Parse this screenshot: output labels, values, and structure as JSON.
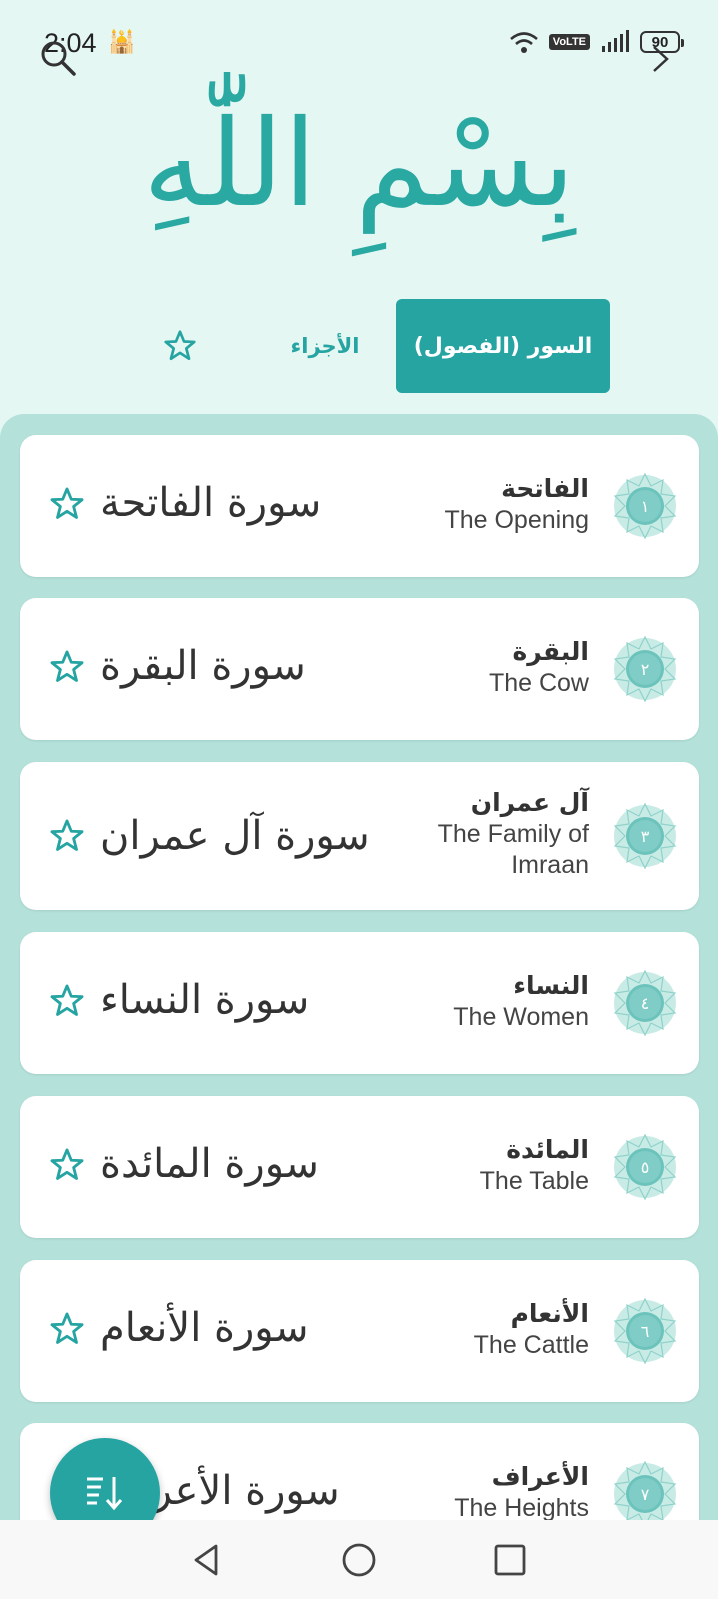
{
  "status_bar": {
    "time": "2:04",
    "network": "VoLTE",
    "battery": "90",
    "icons": [
      "mosque-icon",
      "wifi-icon",
      "volte-icon",
      "signal-icon",
      "battery-icon"
    ]
  },
  "header": {
    "bismillah": "بِسْمِ اللّٰهِ",
    "icons": [
      "search-icon",
      "chevron-right-icon"
    ]
  },
  "tabs": {
    "surahs_label": "السور (الفصول)",
    "juz_label": "الأجزاء",
    "favorites_icon": "star-outline-icon",
    "active": "surahs"
  },
  "surahs": [
    {
      "number": "١",
      "name_ar": "الفاتحة",
      "name_en": "The Opening",
      "calligraphy": "سورة الفاتحة"
    },
    {
      "number": "٢",
      "name_ar": "البقرة",
      "name_en": "The Cow",
      "calligraphy": "سورة البقرة"
    },
    {
      "number": "٣",
      "name_ar": "آل عمران",
      "name_en": "The Family of Imraan",
      "name_en_line1": "The Family of",
      "name_en_line2": "Imraan",
      "calligraphy": "سورة آل عمران"
    },
    {
      "number": "٤",
      "name_ar": "النساء",
      "name_en": "The Women",
      "calligraphy": "سورة النساء"
    },
    {
      "number": "٥",
      "name_ar": "المائدة",
      "name_en": "The Table",
      "calligraphy": "سورة المائدة"
    },
    {
      "number": "٦",
      "name_ar": "الأنعام",
      "name_en": "The Cattle",
      "calligraphy": "سورة الأنعام"
    },
    {
      "number": "٧",
      "name_ar": "الأعراف",
      "name_en": "The Heights",
      "calligraphy": "سورة الأعراف"
    }
  ],
  "fab": {
    "icon": "sort-list-icon"
  },
  "nav_bar": {
    "icons": [
      "nav-back-icon",
      "nav-home-icon",
      "nav-recents-icon"
    ]
  },
  "colors": {
    "accent": "#25a4a2",
    "background": "#e5f7f3",
    "list_background": "#b4e1da",
    "card": "#ffffff",
    "text": "#333333"
  }
}
